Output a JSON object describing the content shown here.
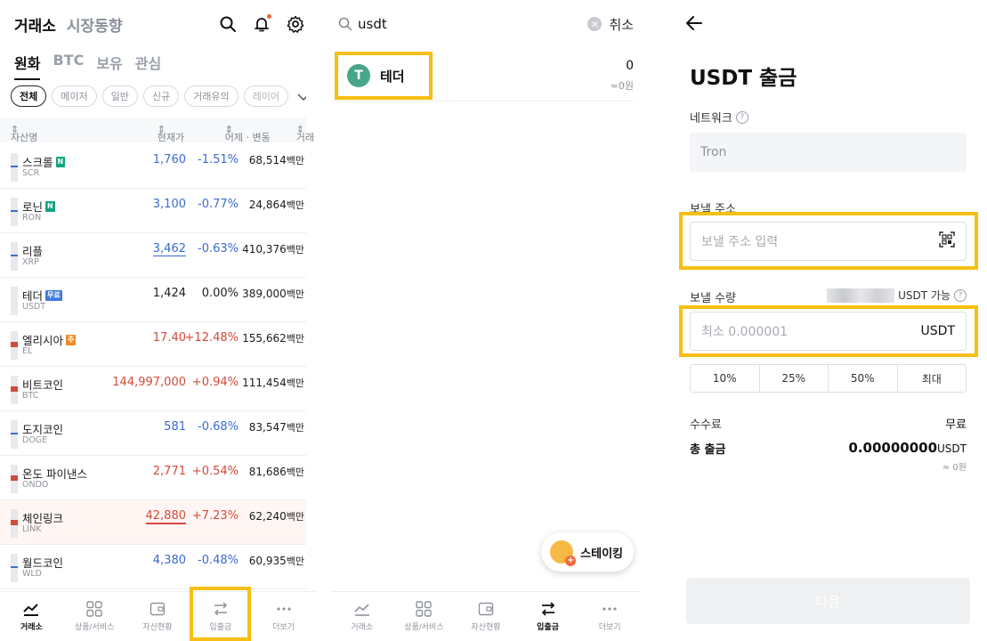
{
  "colors": {
    "up": "#d24a3c",
    "down": "#3b6ad1",
    "highlight": "#f7bf13",
    "tether": "#47a58a"
  },
  "exchange": {
    "title": "거래소",
    "market_trend": "시장동향",
    "tabs": [
      "원화",
      "BTC",
      "보유",
      "관심"
    ],
    "chips": [
      "전체",
      "메이저",
      "일반",
      "신규",
      "거래유의",
      "레이어"
    ],
    "columns": {
      "asset": "자산명",
      "price": "현재가",
      "change": "어제 · 변동",
      "volume": "거래금액"
    },
    "rows": [
      {
        "name": "스크롤",
        "badge": "N",
        "symbol": "SCR",
        "price": "1,760",
        "change": "-1.51%",
        "volume": "68,514",
        "unit": "백만"
      },
      {
        "name": "로닌",
        "badge": "N",
        "symbol": "RON",
        "price": "3,100",
        "change": "-0.77%",
        "volume": "24,864",
        "unit": "백만"
      },
      {
        "name": "리플",
        "badge": "",
        "symbol": "XRP",
        "price": "3,462",
        "change": "-0.63%",
        "volume": "410,376",
        "unit": "백만"
      },
      {
        "name": "테더",
        "badge": "무료",
        "symbol": "USDT",
        "price": "1,424",
        "change": "0.00%",
        "volume": "389,000",
        "unit": "백만"
      },
      {
        "name": "엘리시아",
        "badge": "주",
        "symbol": "EL",
        "price": "17.40",
        "change": "+12.48%",
        "volume": "155,662",
        "unit": "백만"
      },
      {
        "name": "비트코인",
        "badge": "",
        "symbol": "BTC",
        "price": "144,997,000",
        "change": "+0.94%",
        "volume": "111,454",
        "unit": "백만"
      },
      {
        "name": "도지코인",
        "badge": "",
        "symbol": "DOGE",
        "price": "581",
        "change": "-0.68%",
        "volume": "83,547",
        "unit": "백만"
      },
      {
        "name": "온도 파이낸스",
        "badge": "",
        "symbol": "ONDO",
        "price": "2,771",
        "change": "+0.54%",
        "volume": "81,686",
        "unit": "백만"
      },
      {
        "name": "체인링크",
        "badge": "",
        "symbol": "LINK",
        "price": "42,880",
        "change": "+7.23%",
        "volume": "62,240",
        "unit": "백만"
      },
      {
        "name": "월드코인",
        "badge": "",
        "symbol": "WLD",
        "price": "4,380",
        "change": "-0.48%",
        "volume": "60,935",
        "unit": "백만"
      }
    ]
  },
  "nav": {
    "items": [
      "거래소",
      "상품/서비스",
      "자산현황",
      "입출금",
      "더보기"
    ]
  },
  "search": {
    "query": "usdt",
    "cancel": "취소",
    "result": {
      "name": "테더",
      "amount": "0",
      "krw": "≈0원"
    },
    "staking": "스테이킹"
  },
  "withdraw": {
    "title": "USDT 출금",
    "network_label": "네트워크",
    "network_value": "Tron",
    "address_label": "보낼 주소",
    "address_placeholder": "보낼 주소 입력",
    "amount_label": "보낼 수량",
    "available_suffix": "USDT 가능",
    "amount_placeholder": "최소 0.000001",
    "amount_unit": "USDT",
    "percents": [
      "10%",
      "25%",
      "50%",
      "최대"
    ],
    "fee_label": "수수료",
    "fee_value": "무료",
    "total_label": "총 출금",
    "total_value": "0.00000000",
    "total_unit": "USDT",
    "total_krw": "≈ 0원",
    "next": "다음"
  }
}
